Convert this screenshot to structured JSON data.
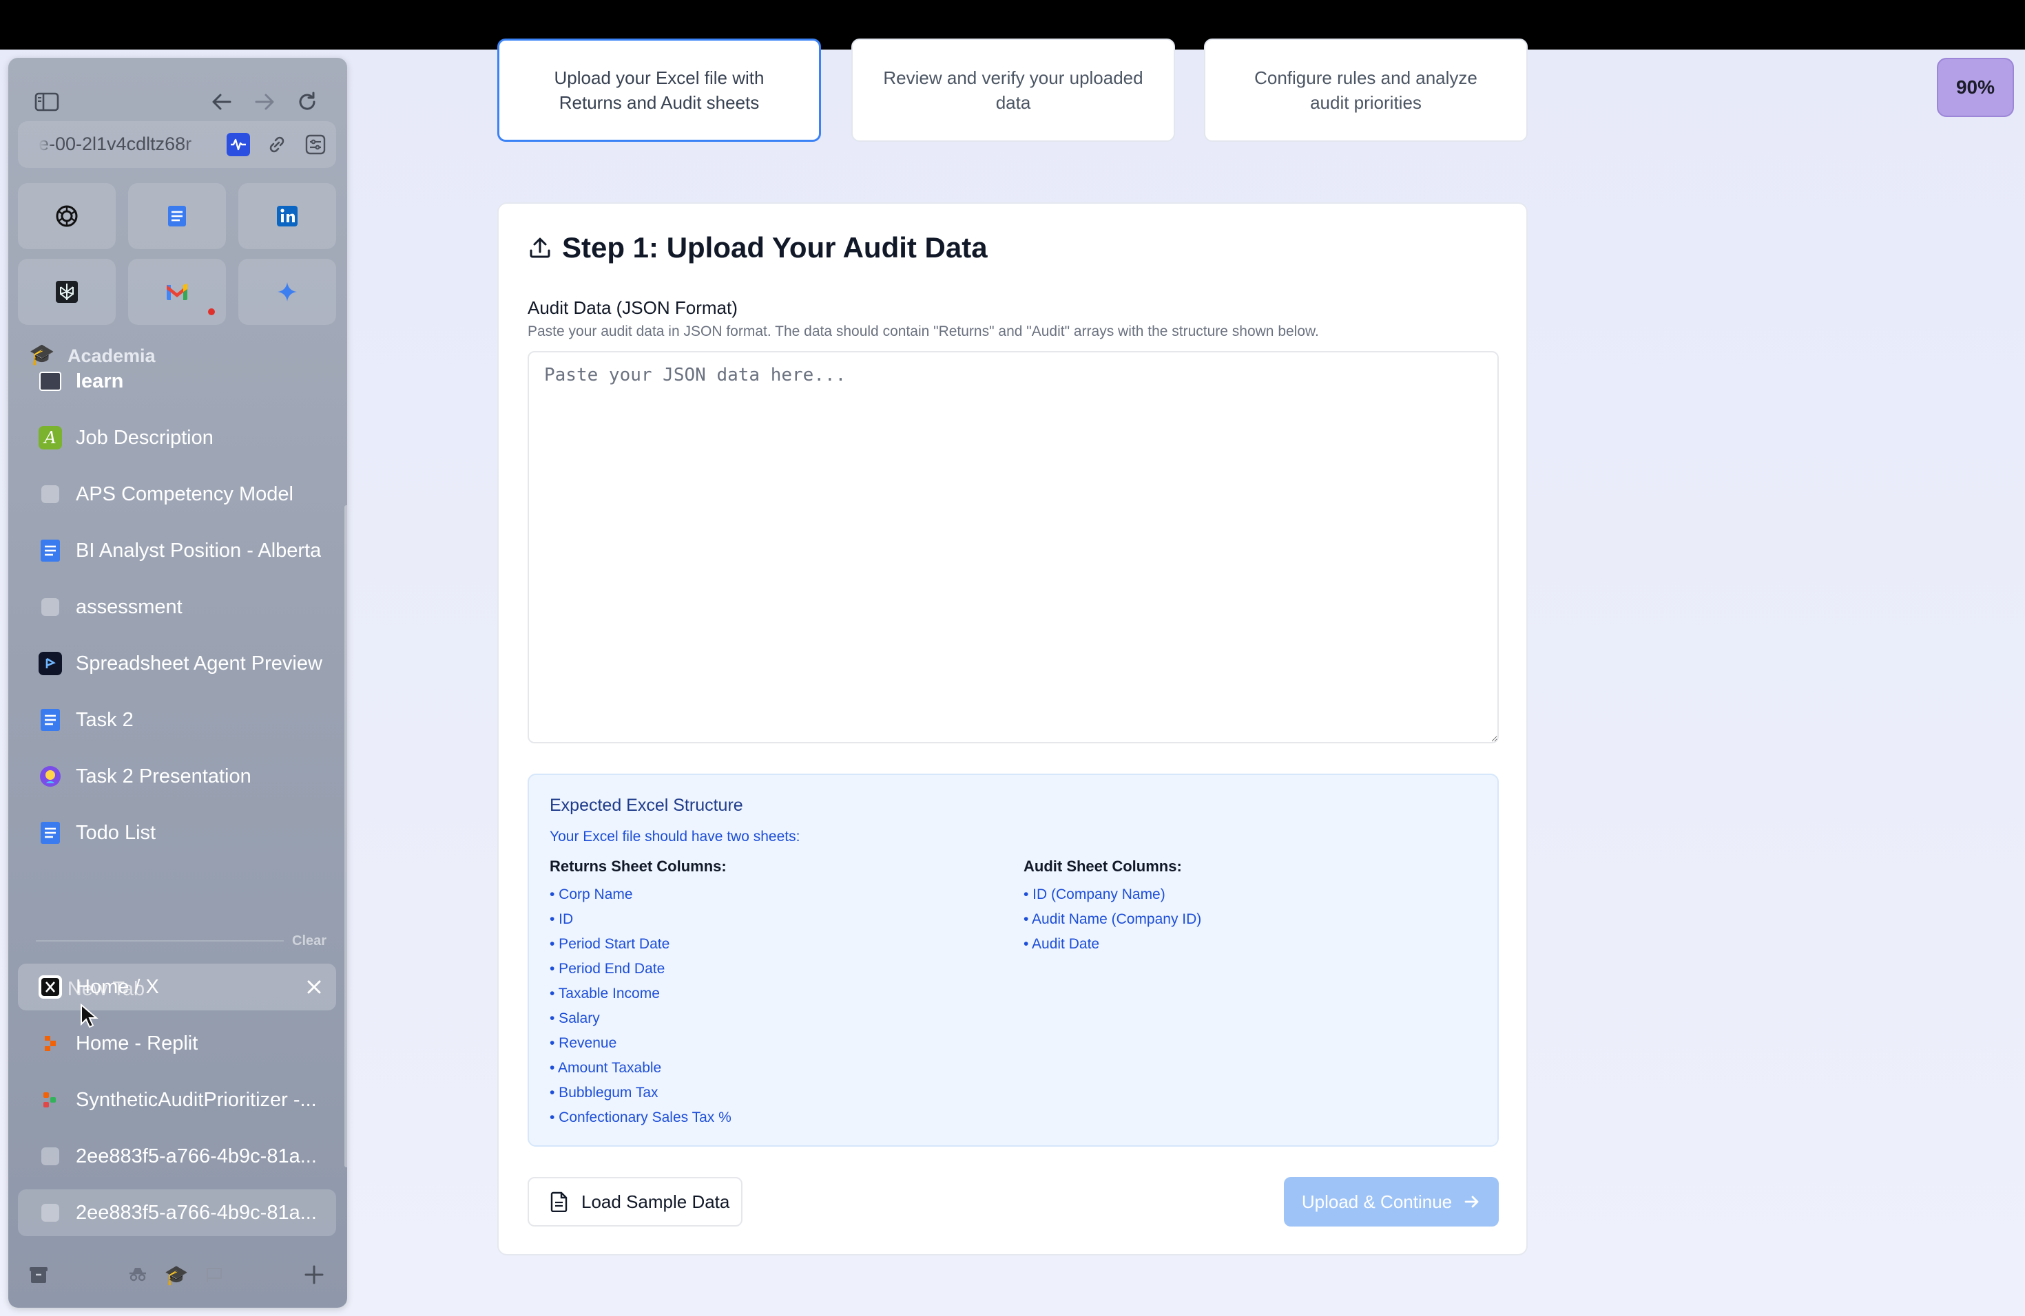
{
  "sidebar": {
    "url_text": "e-00-2l1v4cdltz68r",
    "section_label": "Academia",
    "pinned_tabs": [
      {
        "label": "learn"
      },
      {
        "label": "Job Description"
      },
      {
        "label": "APS Competency Model"
      },
      {
        "label": "BI Analyst Position - Alberta"
      },
      {
        "label": "assessment"
      },
      {
        "label": "Spreadsheet Agent Preview"
      },
      {
        "label": "Task 2"
      },
      {
        "label": "Task 2 Presentation"
      },
      {
        "label": "Todo List"
      }
    ],
    "clear_label": "Clear",
    "new_tab_label": "New Tab",
    "open_tabs": [
      {
        "label": "Home / X"
      },
      {
        "label": "Home - Replit"
      },
      {
        "label": "SyntheticAuditPrioritizer -..."
      },
      {
        "label": "2ee883f5-a766-4b9c-81a..."
      },
      {
        "label": "2ee883f5-a766-4b9c-81a..."
      }
    ]
  },
  "steps": [
    {
      "text": "Upload your Excel file with Returns and Audit sheets"
    },
    {
      "text": "Review and verify your uploaded data"
    },
    {
      "text": "Configure rules and analyze audit priorities"
    }
  ],
  "main": {
    "title": "Step 1: Upload Your Audit Data",
    "field_label": "Audit Data (JSON Format)",
    "field_help": "Paste your audit data in JSON format. The data should contain \"Returns\" and \"Audit\" arrays with the structure shown below.",
    "json_placeholder": "Paste your JSON data here...",
    "expected": {
      "title": "Expected Excel Structure",
      "subtitle": "Your Excel file should have two sheets:",
      "returns_heading": "Returns Sheet Columns:",
      "returns_columns": [
        "• Corp Name",
        "• ID",
        "• Period Start Date",
        "• Period End Date",
        "• Taxable Income",
        "• Salary",
        "• Revenue",
        "• Amount Taxable",
        "• Bubblegum Tax",
        "• Confectionary Sales Tax %"
      ],
      "audit_heading": "Audit Sheet Columns:",
      "audit_columns": [
        "• ID (Company Name)",
        "• Audit Name (Company ID)",
        "• Audit Date"
      ]
    },
    "load_sample_label": "Load Sample Data",
    "upload_label": "Upload & Continue"
  },
  "zoom_badge": "90%",
  "colors": {
    "accent": "#3b82f6",
    "upload_button": "#9ec3f7",
    "zoom_badge": "#b4a0e6"
  }
}
